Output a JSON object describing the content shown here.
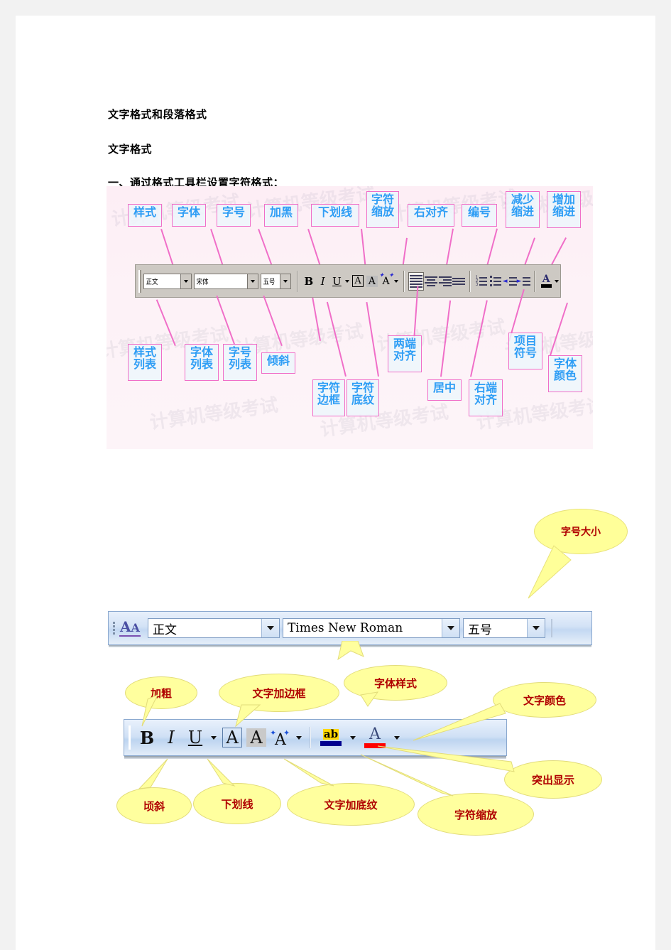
{
  "document": {
    "headings": [
      "文字格式和段落格式",
      "文字格式",
      "一、通过格式工具栏设置字符格式："
    ]
  },
  "figure1": {
    "watermark": "计算机等级考试",
    "toolbar": {
      "style_combo": "正文",
      "font_combo": "宋体",
      "size_combo": "五号",
      "bold": "B",
      "italic": "I",
      "underline": "U"
    },
    "top_labels": [
      "样式",
      "字体",
      "字号",
      "加黑",
      "下划线",
      "字符\n缩放",
      "右对齐",
      "编号",
      "减少\n缩进",
      "增加\n缩进"
    ],
    "bottom_labels": [
      "样式\n列表",
      "字体\n列表",
      "字号\n列表",
      "倾斜",
      "字符\n边框",
      "字符\n底纹",
      "两端\n对齐",
      "居中",
      "右端\n对齐",
      "项目\n符号",
      "字体\n颜色"
    ]
  },
  "figure2": {
    "bubble_label": "字号大小",
    "style_value": "正文",
    "font_value": "Times New Roman",
    "size_value": "五号",
    "style_icon": "style-AA-icon"
  },
  "figure3": {
    "buttons": {
      "bold": "B",
      "italic": "I",
      "underline": "U",
      "border_A": "A",
      "shading_A": "A",
      "highlight": "ab",
      "font_color": "A"
    },
    "labels": {
      "bold": "加粗",
      "border": "文字加边框",
      "font_style": "字体样式",
      "font_color": "文字颜色",
      "italic": "顷斜",
      "underline": "下划线",
      "shading": "文字加底纹",
      "scale": "字符缩放",
      "highlight": "突出显示"
    }
  },
  "colors": {
    "label_text_blue": "#2f9ef5",
    "label_border_pink": "#f06ec8",
    "callout_yellow": "#ffff99",
    "callout_text_red": "#b00000",
    "page_background": "#ffffff",
    "canvas_background": "#f2f2f2"
  }
}
